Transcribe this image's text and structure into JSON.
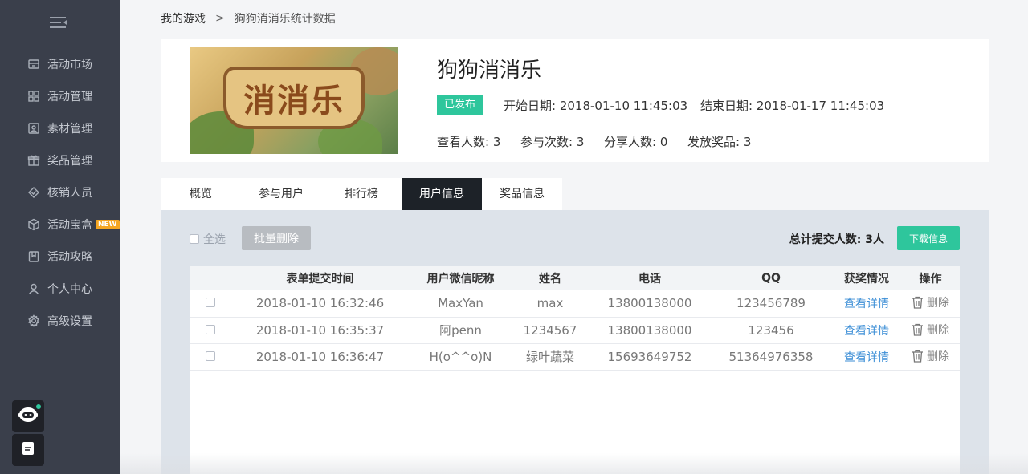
{
  "sidebar": {
    "items": [
      {
        "label": "活动市场",
        "icon": "store-icon"
      },
      {
        "label": "活动管理",
        "icon": "grid-icon"
      },
      {
        "label": "素材管理",
        "icon": "image-icon"
      },
      {
        "label": "奖品管理",
        "icon": "gift-icon"
      },
      {
        "label": "核销人员",
        "icon": "verify-icon"
      },
      {
        "label": "活动宝盒",
        "icon": "box-icon",
        "badge": "NEW"
      },
      {
        "label": "活动攻略",
        "icon": "bookmark-icon"
      },
      {
        "label": "个人中心",
        "icon": "user-icon"
      },
      {
        "label": "高级设置",
        "icon": "gear-icon"
      }
    ]
  },
  "breadcrumb": {
    "parent": "我的游戏",
    "separator": ">",
    "current": "狗狗消消乐统计数据"
  },
  "game": {
    "cover_text": "消消乐",
    "title": "狗狗消消乐",
    "status": "已发布",
    "start_label": "开始日期:",
    "start_value": "2018-01-10 11:45:03",
    "end_label": "结束日期:",
    "end_value": "2018-01-17 11:45:03",
    "views_label": "查看人数:",
    "views_value": "3",
    "plays_label": "参与次数:",
    "plays_value": "3",
    "shares_label": "分享人数:",
    "shares_value": "0",
    "prizes_label": "发放奖品:",
    "prizes_value": "3"
  },
  "tabs": [
    {
      "label": "概览"
    },
    {
      "label": "参与用户"
    },
    {
      "label": "排行榜"
    },
    {
      "label": "用户信息",
      "active": true
    },
    {
      "label": "奖品信息"
    }
  ],
  "toolbar": {
    "select_all": "全选",
    "batch_delete": "批量删除",
    "total": "总计提交人数: 3人",
    "download": "下载信息"
  },
  "table": {
    "headers": [
      "表单提交时间",
      "用户微信昵称",
      "姓名",
      "电话",
      "QQ",
      "获奖情况",
      "操作"
    ],
    "rows": [
      {
        "time": "2018-01-10 16:32:46",
        "nickname": "MaxYan",
        "name": "max",
        "phone": "13800138000",
        "qq": "123456789",
        "prize": "查看详情",
        "op": "删除"
      },
      {
        "time": "2018-01-10 16:35:37",
        "nickname": "阿penn",
        "name": "1234567",
        "phone": "13800138000",
        "qq": "123456",
        "prize": "查看详情",
        "op": "删除"
      },
      {
        "time": "2018-01-10 16:36:47",
        "nickname": "H(o^^o)N",
        "name": "绿叶蔬菜",
        "phone": "15693649752",
        "qq": "51364976358",
        "prize": "查看详情",
        "op": "删除"
      }
    ]
  },
  "colors": {
    "sidebar_bg": "#3a3f4b",
    "accent": "#2ec69c",
    "tab_active": "#1d2228",
    "link": "#3b8ed6",
    "badge_new": "#f5a623"
  }
}
